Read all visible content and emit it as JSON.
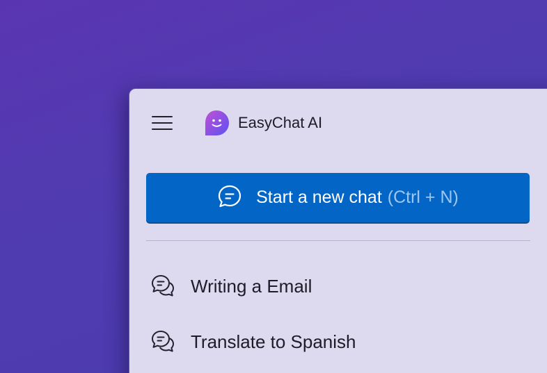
{
  "app": {
    "title": "EasyChat AI",
    "icons": {
      "menu": "hamburger-menu-icon",
      "logo": "easychat-logo-icon"
    }
  },
  "new_chat": {
    "label": "Start a new chat",
    "shortcut": "(Ctrl + N)",
    "icon": "chat-bubble-icon"
  },
  "history": [
    {
      "label": "Writing a Email",
      "icon": "conversation-icon"
    },
    {
      "label": "Translate to Spanish",
      "icon": "conversation-icon"
    }
  ],
  "colors": {
    "background": "#5a35b2",
    "panel": "#ddd9ee",
    "accent": "#0366c6",
    "shortcut_text": "#9ec6ef",
    "logo_gradient_start": "#b44fd8",
    "logo_gradient_end": "#6a4ff0"
  }
}
